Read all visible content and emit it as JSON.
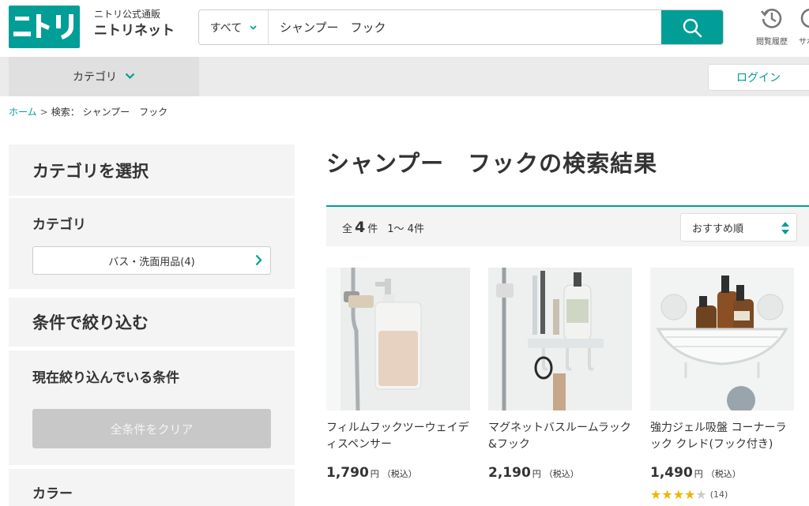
{
  "header": {
    "logo_text": "ニトリ",
    "brand_sub": "ニトリ公式通販",
    "brand_main": "ニトリネット",
    "history_label": "閲覧履歴",
    "support_label": "サポ"
  },
  "search": {
    "scope": "すべて",
    "query": "シャンプー　フック"
  },
  "nav": {
    "category_label": "カテゴリ",
    "login_label": "ログイン"
  },
  "breadcrumb": {
    "home": "ホーム",
    "separator": ">",
    "current": "検索： シャンプー　フック"
  },
  "sidebar": {
    "category_select_title": "カテゴリを選択",
    "category_heading": "カテゴリ",
    "category_item": "バス・洗面用品(4)",
    "filter_title": "条件で絞り込む",
    "current_conditions": "現在絞り込んでいる条件",
    "clear_all": "全条件をクリア",
    "color_heading": "カラー"
  },
  "results": {
    "title": "シャンプー　フックの検索結果",
    "total_prefix": "全",
    "total": "4",
    "total_suffix": "件",
    "range": "1～ 4件",
    "sort": "おすすめ順"
  },
  "products": [
    {
      "name": "フィルムフックツーウェイディスペンサー",
      "price": "1,790",
      "yen": "円",
      "tax": "（税込）"
    },
    {
      "name": "マグネットバスルームラック&フック",
      "price": "2,190",
      "yen": "円",
      "tax": "（税込）"
    },
    {
      "name": "強力ジェル吸盤 コーナーラック クレド(フック付き)",
      "price": "1,490",
      "yen": "円",
      "tax": "（税込）",
      "rating": 4,
      "rating_max": 5,
      "review_count": "(14)"
    }
  ],
  "colors": {
    "accent": "#009e96",
    "star": "#f0b400"
  }
}
